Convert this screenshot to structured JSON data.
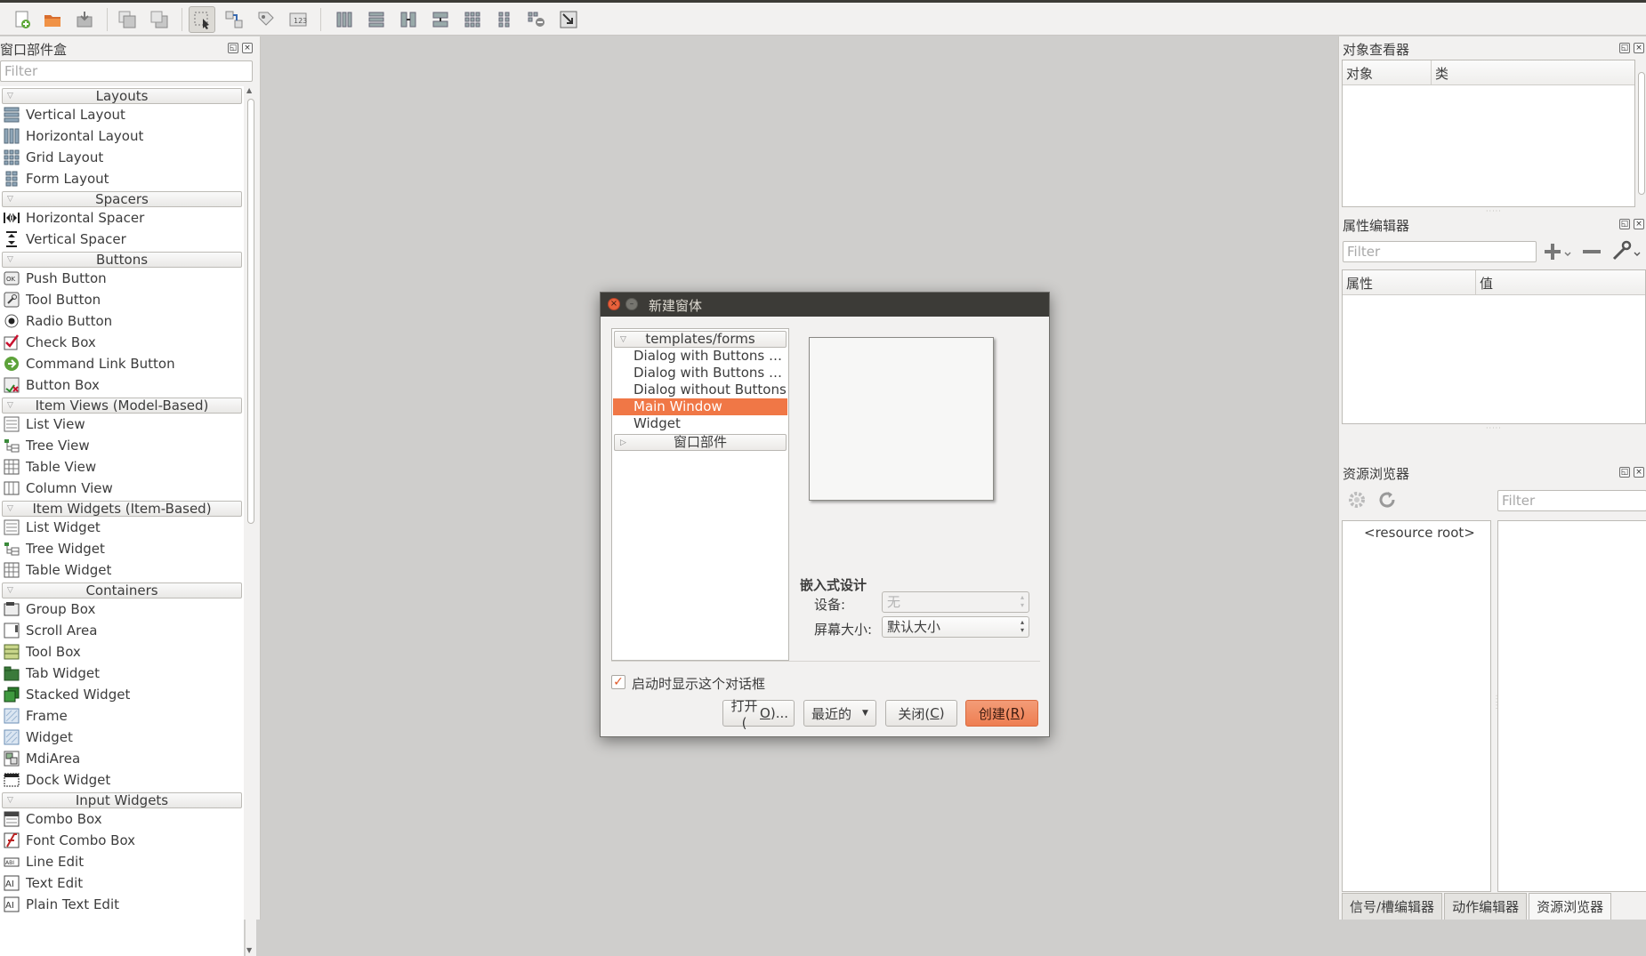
{
  "toolbar": {
    "buttons": [
      "new-form-icon",
      "open-form-icon",
      "save-form-icon",
      "send-to-back-icon",
      "bring-to-front-icon",
      "edit-widgets-icon",
      "edit-signals-icon",
      "edit-buddies-icon",
      "edit-tab-order-icon",
      "layout-horizontal-icon",
      "layout-vertical-icon",
      "layout-h-splitter-icon",
      "layout-v-splitter-icon",
      "layout-grid-icon",
      "layout-form-icon",
      "break-layout-icon",
      "adjust-size-icon"
    ]
  },
  "widget_box": {
    "title": "窗口部件盒",
    "filter_placeholder": "Filter",
    "categories": [
      {
        "label": "Layouts",
        "items": [
          "Vertical Layout",
          "Horizontal Layout",
          "Grid Layout",
          "Form Layout"
        ]
      },
      {
        "label": "Spacers",
        "items": [
          "Horizontal Spacer",
          "Vertical Spacer"
        ]
      },
      {
        "label": "Buttons",
        "items": [
          "Push Button",
          "Tool Button",
          "Radio Button",
          "Check Box",
          "Command Link Button",
          "Button Box"
        ]
      },
      {
        "label": "Item Views (Model-Based)",
        "items": [
          "List View",
          "Tree View",
          "Table View",
          "Column View"
        ]
      },
      {
        "label": "Item Widgets (Item-Based)",
        "items": [
          "List Widget",
          "Tree Widget",
          "Table Widget"
        ]
      },
      {
        "label": "Containers",
        "items": [
          "Group Box",
          "Scroll Area",
          "Tool Box",
          "Tab Widget",
          "Stacked Widget",
          "Frame",
          "Widget",
          "MdiArea",
          "Dock Widget"
        ]
      },
      {
        "label": "Input Widgets",
        "items": [
          "Combo Box",
          "Font Combo Box",
          "Line Edit",
          "Text Edit",
          "Plain Text Edit"
        ]
      }
    ]
  },
  "object_inspector": {
    "title": "对象查看器",
    "col_object": "对象",
    "col_class": "类"
  },
  "property_editor": {
    "title": "属性编辑器",
    "filter_placeholder": "Filter",
    "col_property": "属性",
    "col_value": "值"
  },
  "resource_browser": {
    "title": "资源浏览器",
    "filter_placeholder": "Filter",
    "root": "<resource root>"
  },
  "bottom_tabs": [
    "信号/槽编辑器",
    "动作编辑器",
    "资源浏览器"
  ],
  "dialog": {
    "title": "新建窗体",
    "template_category": "templates/forms",
    "templates": [
      "Dialog with Buttons Bottom",
      "Dialog with Buttons Right",
      "Dialog without Buttons",
      "Main Window",
      "Widget"
    ],
    "selected_template": "Main Window",
    "widgets_category": "窗口部件",
    "embedded_title": "嵌入式设计",
    "device_label": "设备:",
    "device_value": "无",
    "screen_size_label": "屏幕大小:",
    "screen_size_value": "默认大小",
    "show_on_startup_label": "启动时显示这个对话框",
    "show_on_startup_checked": true,
    "buttons": {
      "open": "打开(",
      "open_mnemonic": "O",
      "open_suffix": ")...",
      "recent": "最近的",
      "close": "关闭(",
      "close_mnemonic": "C",
      "close_suffix": ")",
      "create": "创建(",
      "create_mnemonic": "R",
      "create_suffix": ")"
    }
  },
  "colors": {
    "selection": "#f07746",
    "title_bar": "#3c3b37",
    "workspace": "#cfcecc"
  }
}
